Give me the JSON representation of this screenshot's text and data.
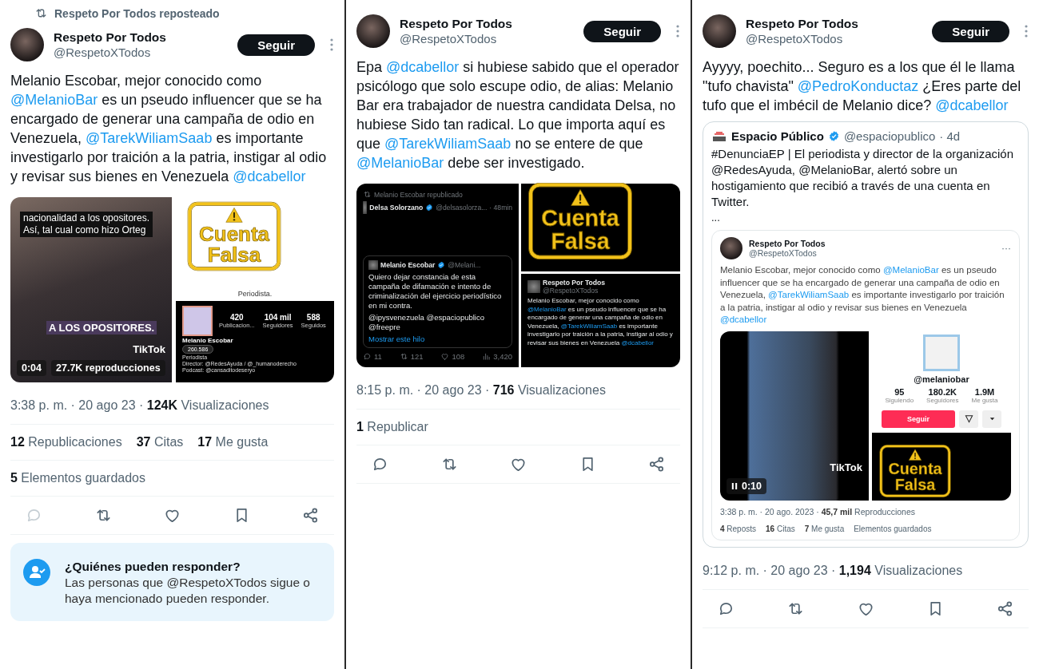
{
  "panels": [
    {
      "repost_label": "Respeto Por Todos reposteado",
      "author": {
        "name": "Respeto Por Todos",
        "handle": "@RespetoXTodos"
      },
      "follow_label": "Seguir",
      "body": [
        {
          "kind": "text",
          "text": "Melanio Escobar, mejor conocido como "
        },
        {
          "kind": "mention",
          "text": "@MelanioBar"
        },
        {
          "kind": "text",
          "text": " es un pseudo influencer que se ha encargado de generar una campaña de odio en Venezuela, "
        },
        {
          "kind": "mention",
          "text": "@TarekWiliamSaab"
        },
        {
          "kind": "text",
          "text": " es importante investigarlo por traición a la patria, instigar al odio y revisar sus bienes en Venezuela "
        },
        {
          "kind": "mention",
          "text": "@dcabellor"
        }
      ],
      "media": {
        "kind": "video_profile",
        "stamp": {
          "lines": [
            "Cuenta",
            "Falsa"
          ]
        },
        "video": {
          "caption_top": [
            "nacionalidad a los opositores.",
            "Así, tal cual como hizo Orteg"
          ],
          "caption_bottom": "A LOS OPOSITORES.",
          "brand": "TikTok",
          "paused": false,
          "duration": "0:04",
          "plays": "27.7K reproducciones"
        },
        "profile": {
          "bio": "Periodista.",
          "dark": {
            "stats": [
              {
                "value": "420",
                "label": "Publicacion..."
              },
              {
                "value": "104 mil",
                "label": "Seguidores"
              },
              {
                "value": "588",
                "label": "Seguidos"
              }
            ],
            "name": "Melanio Escobar",
            "badge": "260.586",
            "lines": [
              "Periodista",
              "Director: @RedesAyuda / @_humanoderecho",
              "Podcast: @cansaditodeseryo"
            ]
          }
        }
      },
      "meta": "3:38 p. m. · 20 ago 23 · **124K** Visualizaciones",
      "stat_rows": [
        [
          "**12** Republicaciones",
          "**37** Citas",
          "**17** Me gusta"
        ],
        [
          "**5** Elementos guardados"
        ]
      ],
      "actions": [
        {
          "kind": "reply",
          "disabled": true
        },
        {
          "kind": "retweet",
          "disabled": false
        },
        {
          "kind": "like",
          "disabled": false
        },
        {
          "kind": "bookmark",
          "disabled": false
        },
        {
          "kind": "share",
          "disabled": false
        }
      ],
      "reply_notice": {
        "title": "¿Quiénes pueden responder?",
        "text": "Las personas que @RespetoXTodos sigue o haya mencionado pueden responder."
      }
    },
    {
      "author": {
        "name": "Respeto Por Todos",
        "handle": "@RespetoXTodos"
      },
      "follow_label": "Seguir",
      "body": [
        {
          "kind": "text",
          "text": "Epa "
        },
        {
          "kind": "mention",
          "text": "@dcabellor"
        },
        {
          "kind": "text",
          "text": " si hubiese sabido que el operador psicólogo que solo escupe odio, de alias: Melanio Bar era trabajador de nuestra candidata Delsa, no hubiese Sido tan radical. Lo que importa aquí es que "
        },
        {
          "kind": "mention",
          "text": "@TarekWiliamSaab"
        },
        {
          "kind": "text",
          "text": " no se entere de que "
        },
        {
          "kind": "mention",
          "text": "@MelanioBar"
        },
        {
          "kind": "text",
          "text": " debe ser investigado."
        }
      ],
      "media": {
        "kind": "tweet_collage",
        "stamp": {
          "lines": [
            "Cuenta",
            "Falsa"
          ]
        },
        "left": {
          "repost_label": "Melanio Escobar republicado",
          "author": "Delsa Solorzano",
          "handle": "@delsasolorza...",
          "time": "· 48min",
          "quote": {
            "author": "Melanio Escobar",
            "handle": "@Melani...",
            "text": "Quiero dejar constancia de esta campaña de difamación e intento de criminalización del ejercicio periodístico en mi contra.",
            "mentions": "@ipysvenezuela @espaciopublico @freepre",
            "link": "Mostrar este hilo"
          },
          "counts": [
            {
              "kind": "reply",
              "value": "11"
            },
            {
              "kind": "retweet",
              "value": "121"
            },
            {
              "kind": "like",
              "value": "108"
            },
            {
              "kind": "views",
              "value": "3,420"
            }
          ]
        },
        "right": {
          "author": "Respeto Por Todos",
          "handle": "@RespetoXTodos",
          "body": [
            {
              "kind": "text",
              "text": "Melanio Escobar, mejor conocido como "
            },
            {
              "kind": "mention",
              "text": "@MelanioBar"
            },
            {
              "kind": "text",
              "text": " es un pseudo influencer que se ha encargado de generar una campaña de odio en Venezuela, "
            },
            {
              "kind": "mention",
              "text": "@TarekWiliamSaab"
            },
            {
              "kind": "text",
              "text": " es importante investigarlo por traición a la patria, instigar al odio y revisar sus bienes en Venezuela "
            },
            {
              "kind": "mention",
              "text": "@dcabellor"
            }
          ]
        }
      },
      "meta": "8:15 p. m. · 20 ago 23 · **716** Visualizaciones",
      "stat_rows": [
        [
          "**1** Republicar"
        ]
      ],
      "actions": [
        {
          "kind": "reply",
          "disabled": false
        },
        {
          "kind": "retweet",
          "disabled": false
        },
        {
          "kind": "like",
          "disabled": false
        },
        {
          "kind": "bookmark",
          "disabled": false
        },
        {
          "kind": "share",
          "disabled": false
        }
      ]
    },
    {
      "author": {
        "name": "Respeto Por Todos",
        "handle": "@RespetoXTodos"
      },
      "follow_label": "Seguir",
      "body": [
        {
          "kind": "text",
          "text": "Ayyyy, poechito... Seguro es a los que él le llama \"tufo chavista\" "
        },
        {
          "kind": "mention",
          "text": "@PedroKonductaz"
        },
        {
          "kind": "text",
          "text": " ¿Eres parte del tufo que el imbécil de Melanio dice? "
        },
        {
          "kind": "mention",
          "text": "@dcabellor"
        }
      ],
      "quote": {
        "author": "Espacio Público",
        "handle": "@espaciopublico",
        "time": "· 4d",
        "text": "#DenunciaEP | El periodista y director de la organización @RedesAyuda, @MelanioBar, alertó sobre un hostigamiento que recibió a través de una cuenta en Twitter.",
        "ellipsis": "...",
        "post": {
          "author": "Respeto Por Todos",
          "handle": "@RespetoXTodos",
          "more": "···",
          "body": [
            {
              "kind": "text",
              "text": "Melanio Escobar, mejor conocido como "
            },
            {
              "kind": "mention",
              "text": "@MelanioBar"
            },
            {
              "kind": "text",
              "text": " es un pseudo influencer que se ha encargado de generar una campaña de odio en Venezuela, "
            },
            {
              "kind": "mention",
              "text": "@TarekWiliamSaab"
            },
            {
              "kind": "text",
              "text": " es importante investigarlo por traición a la patria, instigar al odio y revisar sus bienes en Venezuela "
            },
            {
              "kind": "mention",
              "text": "@dcabellor"
            }
          ],
          "media": {
            "kind": "video_profile",
            "stamp": {
              "lines": [
                "Cuenta",
                "Falsa"
              ]
            },
            "video": {
              "brand": "TikTok",
              "paused": true,
              "duration": "0:10"
            },
            "profile": {
              "handle": "@melaniobar",
              "stats": [
                {
                  "value": "95",
                  "label": "Siguiendo"
                },
                {
                  "value": "180.2K",
                  "label": "Seguidores"
                },
                {
                  "value": "1.9M",
                  "label": "Me gusta"
                }
              ],
              "follow": "Seguir"
            }
          },
          "meta": "3:38 p. m. · 20 ago. 2023 · **45,7 mil** Reproducciones",
          "stats": [
            "**4** Reposts",
            "**16** Citas",
            "**7** Me gusta",
            "Elementos guardados"
          ]
        }
      },
      "meta": "9:12 p. m. · 20 ago 23 · **1,194** Visualizaciones",
      "actions": [
        {
          "kind": "reply",
          "disabled": false
        },
        {
          "kind": "retweet",
          "disabled": false
        },
        {
          "kind": "like",
          "disabled": false
        },
        {
          "kind": "bookmark",
          "disabled": false
        },
        {
          "kind": "share",
          "disabled": false
        }
      ]
    }
  ]
}
